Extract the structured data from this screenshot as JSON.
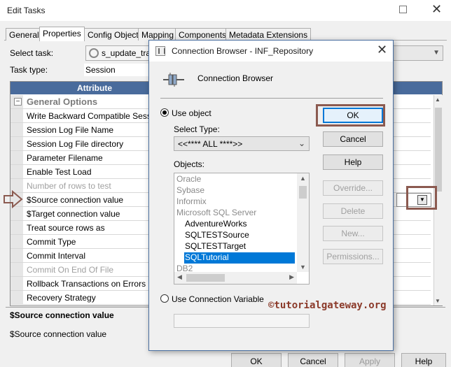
{
  "window": {
    "title": "Edit Tasks"
  },
  "tabs": [
    "General",
    "Properties",
    "Config Object",
    "Mapping",
    "Components",
    "Metadata Extensions"
  ],
  "active_tab": "Properties",
  "select_task": {
    "label": "Select task:",
    "value": "s_update_tran"
  },
  "task_type": {
    "label": "Task type:",
    "value": "Session"
  },
  "grid": {
    "header": "Attribute",
    "group": "General Options",
    "rows": [
      {
        "name": "Write Backward Compatible Session",
        "disabled": false
      },
      {
        "name": "Session Log File Name",
        "disabled": false
      },
      {
        "name": "Session Log File directory",
        "disabled": false
      },
      {
        "name": "Parameter Filename",
        "disabled": false
      },
      {
        "name": "Enable Test Load",
        "disabled": false
      },
      {
        "name": "Number of rows to test",
        "disabled": true
      },
      {
        "name": "$Source connection value",
        "disabled": false
      },
      {
        "name": "$Target connection value",
        "disabled": false
      },
      {
        "name": "Treat source rows as",
        "disabled": false
      },
      {
        "name": "Commit Type",
        "disabled": false
      },
      {
        "name": "Commit Interval",
        "disabled": false
      },
      {
        "name": "Commit On End Of File",
        "disabled": true
      },
      {
        "name": "Rollback Transactions on Errors",
        "disabled": false
      },
      {
        "name": "Recovery Strategy",
        "disabled": false
      }
    ]
  },
  "description": {
    "title": "$Source connection value",
    "text": "$Source connection value"
  },
  "bottom_buttons": {
    "ok": "OK",
    "cancel": "Cancel",
    "apply": "Apply",
    "help": "Help"
  },
  "dialog": {
    "title": "Connection Browser - INF_Repository",
    "heading": "Connection Browser",
    "use_object": "Use object",
    "select_type_label": "Select Type:",
    "select_type_value": "<<**** ALL ****>>",
    "objects_label": "Objects:",
    "objects": [
      {
        "text": "Oracle",
        "grey": true,
        "sub": false
      },
      {
        "text": "Sybase",
        "grey": true,
        "sub": false
      },
      {
        "text": "Informix",
        "grey": true,
        "sub": false
      },
      {
        "text": "Microsoft SQL Server",
        "grey": true,
        "sub": false
      },
      {
        "text": "AdventureWorks",
        "grey": false,
        "sub": true
      },
      {
        "text": "SQLTESTSource",
        "grey": false,
        "sub": true
      },
      {
        "text": "SQLTESTTarget",
        "grey": false,
        "sub": true
      },
      {
        "text": "SQLTutorial",
        "grey": false,
        "sub": true,
        "selected": true
      },
      {
        "text": "DB2",
        "grey": true,
        "sub": false
      }
    ],
    "use_connection_variable": "Use Connection Variable",
    "buttons": {
      "ok": "OK",
      "cancel": "Cancel",
      "help": "Help",
      "override": "Override...",
      "delete": "Delete",
      "new": "New...",
      "permissions": "Permissions..."
    },
    "watermark": "©tutorialgateway.org"
  },
  "colors": {
    "grid_header": "#496b9c",
    "highlight_box": "#8b5a50",
    "selection": "#0078d7",
    "watermark": "#8b3a2a"
  }
}
